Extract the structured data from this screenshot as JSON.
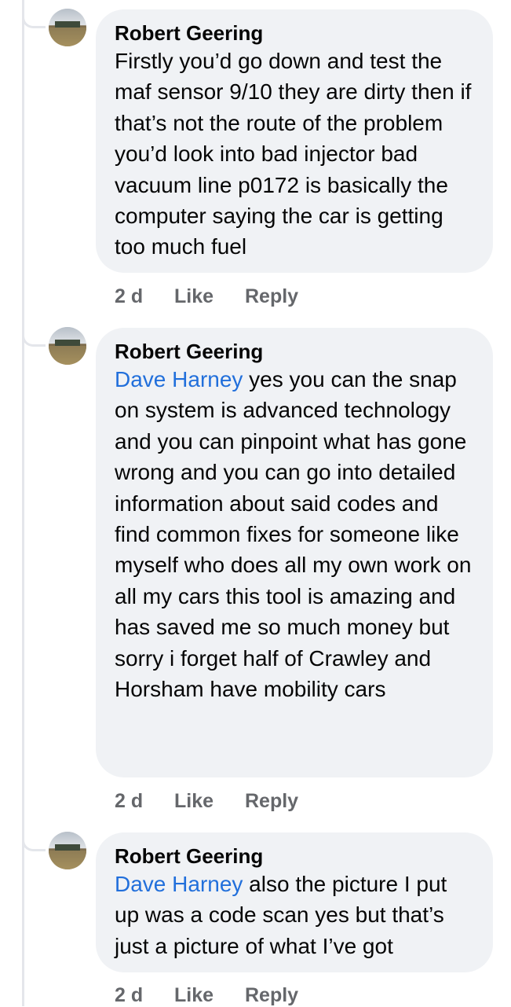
{
  "comments": [
    {
      "author": "Robert Geering",
      "mention": "",
      "text": "Firstly you’d go down and test the maf sensor 9/10 they are dirty then if that’s not the route of the problem you’d look into bad injector bad vacuum line p0172 is basically the computer saying the car is getting too much fuel",
      "time": "2 d",
      "like_label": "Like",
      "reply_label": "Reply"
    },
    {
      "author": "Robert Geering",
      "mention": "Dave Harney",
      "text": " yes you can the snap on system is advanced technology and you can pinpoint what has gone wrong and you can go into detailed information about said codes and find common fixes for someone like myself who does all my own work on all my cars this tool is amazing and has saved me so much money but sorry i forget half of Crawley and Horsham have mobility cars",
      "time": "2 d",
      "like_label": "Like",
      "reply_label": "Reply"
    },
    {
      "author": "Robert Geering",
      "mention": "Dave Harney",
      "text": " also the picture I put up was a code scan yes but that’s just a picture of what I’ve got",
      "time": "2 d",
      "like_label": "Like",
      "reply_label": "Reply"
    }
  ],
  "colors": {
    "bubble": "#f0f2f5",
    "mention": "#216fdb",
    "meta": "#65676b"
  },
  "icons": {
    "avatar": "profile-photo-field-icon"
  }
}
